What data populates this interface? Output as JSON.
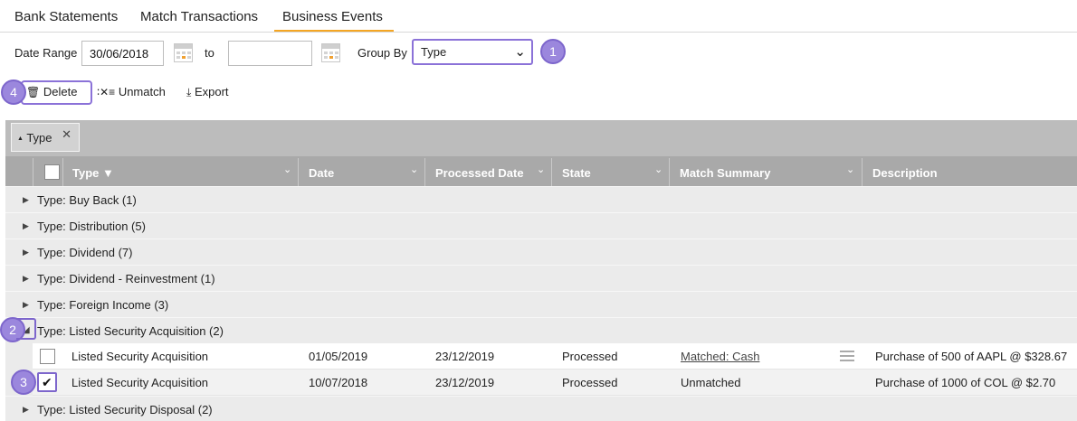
{
  "tabs": [
    "Bank Statements",
    "Match Transactions",
    "Business Events"
  ],
  "filters": {
    "date_range_label": "Date Range",
    "date_from": "30/06/2018",
    "to_label": "to",
    "date_to": "",
    "group_by_label": "Group By",
    "group_by_value": "Type"
  },
  "toolbar": {
    "delete": "Delete",
    "unmatch": "Unmatch",
    "export": "Export"
  },
  "callouts": [
    "1",
    "2",
    "3",
    "4"
  ],
  "grid": {
    "group_chip": "Type",
    "columns": [
      "Type ▼",
      "Date",
      "Processed Date",
      "State",
      "Match Summary",
      "Description"
    ],
    "groups": [
      "Type: Buy Back (1)",
      "Type: Distribution (5)",
      "Type: Dividend (7)",
      "Type: Dividend - Reinvestment (1)",
      "Type: Foreign Income (3)",
      "Type: Listed Security Acquisition (2)",
      "Type: Listed Security Disposal (2)"
    ],
    "rows": [
      {
        "checked": false,
        "type": "Listed Security Acquisition",
        "date": "01/05/2019",
        "processed": "23/12/2019",
        "state": "Processed",
        "match": "Matched: Cash",
        "description": "Purchase of 500 of AAPL @ $328.67"
      },
      {
        "checked": true,
        "type": "Listed Security Acquisition",
        "date": "10/07/2018",
        "processed": "23/12/2019",
        "state": "Processed",
        "match": "Unmatched",
        "description": "Purchase of 1000 of COL @ $2.70"
      }
    ]
  },
  "colors": {
    "accent_tab": "#f5a623",
    "callout": "#9b87dd",
    "header_bg": "#a9a9a9"
  }
}
